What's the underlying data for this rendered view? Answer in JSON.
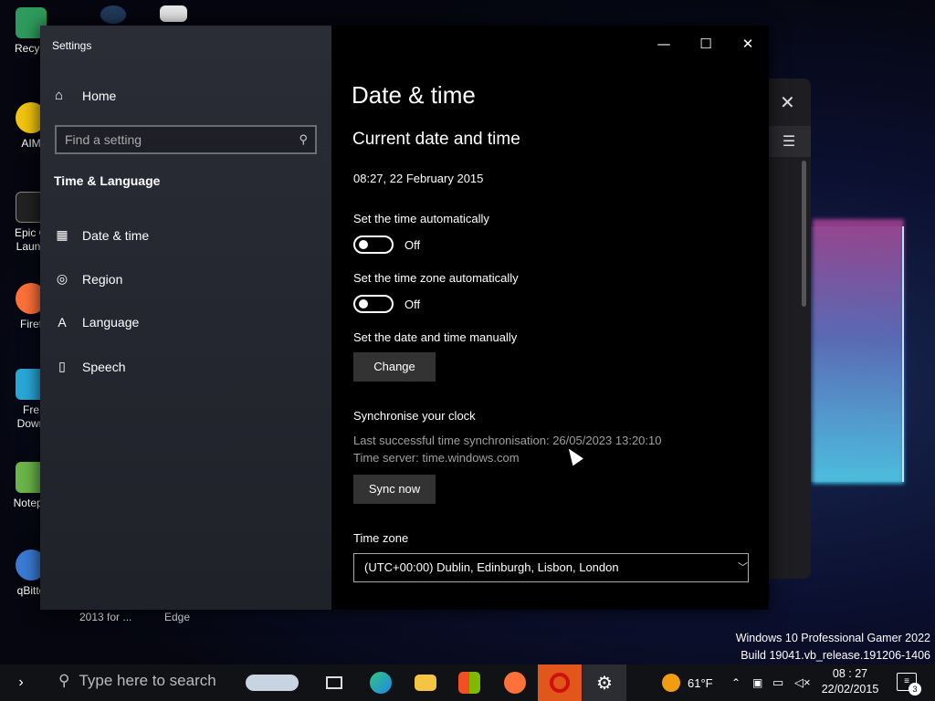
{
  "desktop": {
    "icons": [
      {
        "label": "Recycl",
        "color": "#2e9b5c"
      },
      {
        "label": "AIM",
        "color": "#f1c40f"
      },
      {
        "label": "Epic G\nLaunc",
        "color": "#222222"
      },
      {
        "label": "Firef",
        "color": "#ff7139"
      },
      {
        "label": "Fre\nDown",
        "color": "#2aa7d8"
      },
      {
        "label": "Notepa",
        "color": "#6bb54a"
      },
      {
        "label": "qBitto",
        "color": "#3a7bd5"
      }
    ],
    "bottom_labels": [
      "2013 for ...",
      "Edge"
    ],
    "watermark_line1": "Windows 10 Professional Gamer 2022",
    "watermark_line2": "Build 19041.vb_release.191206-1406"
  },
  "settings": {
    "window_title": "Settings",
    "caption": {
      "minimize": "—",
      "maximize": "☐",
      "close": "✕"
    },
    "nav": {
      "home_label": "Home",
      "home_icon": "home-icon",
      "search_placeholder": "Find a setting",
      "section_title": "Time & Language",
      "items": [
        {
          "label": "Date & time",
          "icon": "calendar-clock-icon"
        },
        {
          "label": "Region",
          "icon": "globe-icon"
        },
        {
          "label": "Language",
          "icon": "language-icon"
        },
        {
          "label": "Speech",
          "icon": "microphone-icon"
        }
      ]
    },
    "content": {
      "page_title": "Date & time",
      "section_title": "Current date and time",
      "current_datetime": "08:27, 22 February 2015",
      "auto_time_label": "Set the time automatically",
      "auto_time_state": "Off",
      "auto_tz_label": "Set the time zone automatically",
      "auto_tz_state": "Off",
      "manual_label": "Set the date and time manually",
      "change_button": "Change",
      "sync_title": "Synchronise your clock",
      "last_sync": "Last successful time synchronisation: 26/05/2023 13:20:10",
      "time_server": "Time server: time.windows.com",
      "sync_button": "Sync now",
      "timezone_label": "Time zone",
      "timezone_value": "(UTC+00:00) Dublin, Edinburgh, Lisbon, London"
    }
  },
  "taskbar": {
    "search_placeholder": "Type here to search",
    "weather_temp": "61°F",
    "clock_time": "08 : 27",
    "clock_date": "22/02/2015",
    "notification_count": "3",
    "accent": "#e0561b"
  }
}
